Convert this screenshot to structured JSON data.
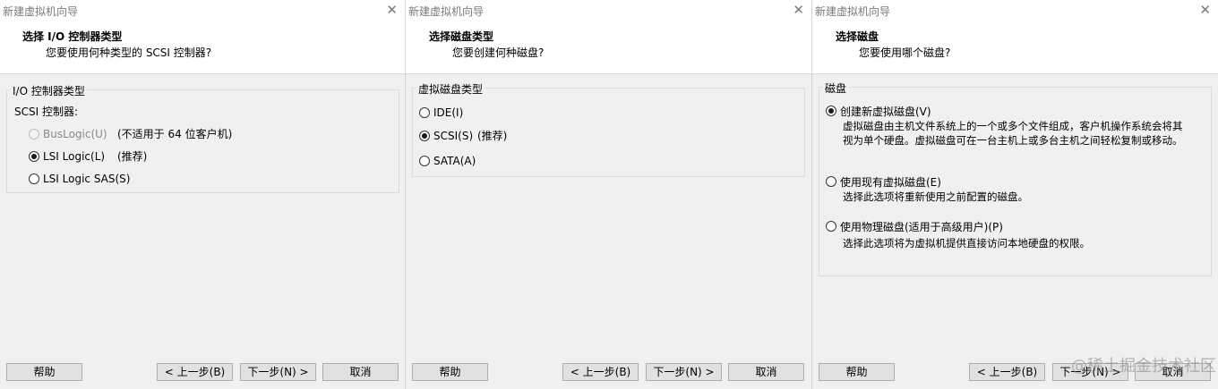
{
  "window_title": "新建虚拟机向导",
  "close_glyph": "✕",
  "buttons": {
    "help": "帮助",
    "back": "< 上一步(B)",
    "next": "下一步(N) >",
    "cancel": "取消"
  },
  "panel1": {
    "title": "选择 I/O 控制器类型",
    "subtitle": "您要使用何种类型的 SCSI 控制器?",
    "group_label": "I/O 控制器类型",
    "scsi_label": "SCSI 控制器:",
    "options": [
      {
        "label": "BusLogic(U)",
        "note": "(不适用于 64 位客户机)",
        "checked": false,
        "disabled": true
      },
      {
        "label": "LSI Logic(L)",
        "note": "(推荐)",
        "checked": true,
        "disabled": false
      },
      {
        "label": "LSI Logic SAS(S)",
        "note": "",
        "checked": false,
        "disabled": false
      }
    ]
  },
  "panel2": {
    "title": "选择磁盘类型",
    "subtitle": "您要创建何种磁盘?",
    "group_label": "虚拟磁盘类型",
    "options": [
      {
        "label": "IDE(I)",
        "note": "",
        "checked": false
      },
      {
        "label": "SCSI(S)",
        "note": "(推荐)",
        "checked": true
      },
      {
        "label": "SATA(A)",
        "note": "",
        "checked": false
      }
    ]
  },
  "panel3": {
    "title": "选择磁盘",
    "subtitle": "您要使用哪个磁盘?",
    "group_label": "磁盘",
    "options": [
      {
        "label": "创建新虚拟磁盘(V)",
        "checked": true,
        "desc_line1": "虚拟磁盘由主机文件系统上的一个或多个文件组成，客户机操作系统会将其",
        "desc_line2": "视为单个硬盘。虚拟磁盘可在一台主机上或多台主机之间轻松复制或移动。"
      },
      {
        "label": "使用现有虚拟磁盘(E)",
        "checked": false,
        "desc_line1": "选择此选项将重新使用之前配置的磁盘。"
      },
      {
        "label": "使用物理磁盘(适用于高级用户)(P)",
        "checked": false,
        "desc_line1": "选择此选项将为虚拟机提供直接访问本地硬盘的权限。"
      }
    ]
  },
  "watermark": "@稀土掘金技术社区"
}
